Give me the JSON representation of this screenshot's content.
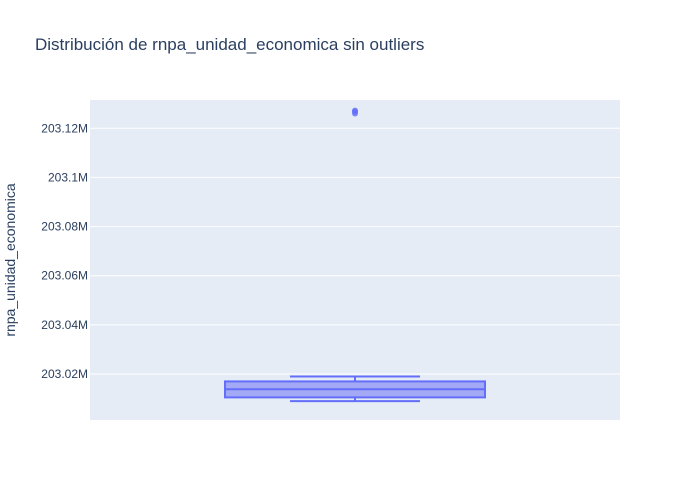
{
  "chart_data": {
    "type": "box",
    "title": "Distribución de rnpa_unidad_economica sin outliers",
    "xlabel": "",
    "ylabel": "rnpa_unidad_economica",
    "ylim": [
      203001300,
      203131500
    ],
    "y_ticks": [
      203020000,
      203040000,
      203060000,
      203080000,
      203100000,
      203120000
    ],
    "y_tick_labels": [
      "203.02M",
      "203.04M",
      "203.06M",
      "203.08M",
      "203.1M",
      "203.12M"
    ],
    "grid": true,
    "legend": "none",
    "box": {
      "lower_fence": 203009000,
      "q1": 203010500,
      "median": 203013800,
      "q3": 203017000,
      "upper_fence": 203019000,
      "points": [
        203126000,
        203126800,
        203127200
      ]
    },
    "colors": {
      "plot_background": "#e5ecf6",
      "grid": "#ffffff",
      "box_line": "#636efa",
      "box_fill": "#a4a9f5",
      "text": "#2a3f5f"
    }
  }
}
